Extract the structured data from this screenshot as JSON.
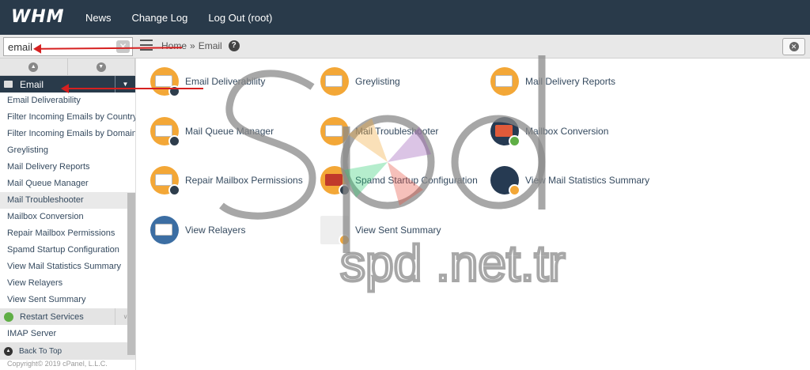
{
  "header": {
    "logo": "WHM",
    "nav": [
      "News",
      "Change Log",
      "Log Out (root)"
    ]
  },
  "search": {
    "value": "email",
    "clear_glyph": "✕"
  },
  "breadcrumb": {
    "home": "Home",
    "sep": "»",
    "current": "Email",
    "help_glyph": "?"
  },
  "close_glyph": "✕",
  "sidebar": {
    "category": "Email",
    "category_toggle": "▼",
    "items": [
      "Email Deliverability",
      "Filter Incoming Emails by Country",
      "Filter Incoming Emails by Domain",
      "Greylisting",
      "Mail Delivery Reports",
      "Mail Queue Manager",
      "Mail Troubleshooter",
      "Mailbox Conversion",
      "Repair Mailbox Permissions",
      "Spamd Startup Configuration",
      "View Mail Statistics Summary",
      "View Relayers",
      "View Sent Summary"
    ],
    "active_index": 6,
    "category2": "Restart Services",
    "category2_toggle": "∨",
    "category2_item": "IMAP Server",
    "back_to_top": "Back To Top",
    "copyright": "Copyright© 2019 cPanel, L.L.C."
  },
  "tiles": [
    {
      "label": "Email Deliverability",
      "color": "#f3a737"
    },
    {
      "label": "Greylisting",
      "color": "#f3a737"
    },
    {
      "label": "Mail Delivery Reports",
      "color": "#f3a737"
    },
    {
      "label": "Mail Queue Manager",
      "color": "#f3a737"
    },
    {
      "label": "Mail Troubleshooter",
      "color": "#f3a737"
    },
    {
      "label": "Mailbox Conversion",
      "color": "#263a52"
    },
    {
      "label": "Repair Mailbox Permissions",
      "color": "#f3a737"
    },
    {
      "label": "Spamd Startup Configuration",
      "color": "#f3a737"
    },
    {
      "label": "View Mail Statistics Summary",
      "color": "#263a52"
    },
    {
      "label": "View Relayers",
      "color": "#263a52"
    },
    {
      "label": "View Sent Summary",
      "color": "#f3a737"
    }
  ],
  "watermark": "spd .net.tr",
  "colors": {
    "topbar": "#293a4a",
    "accent": "#f3a737",
    "arrow": "#d62020"
  }
}
